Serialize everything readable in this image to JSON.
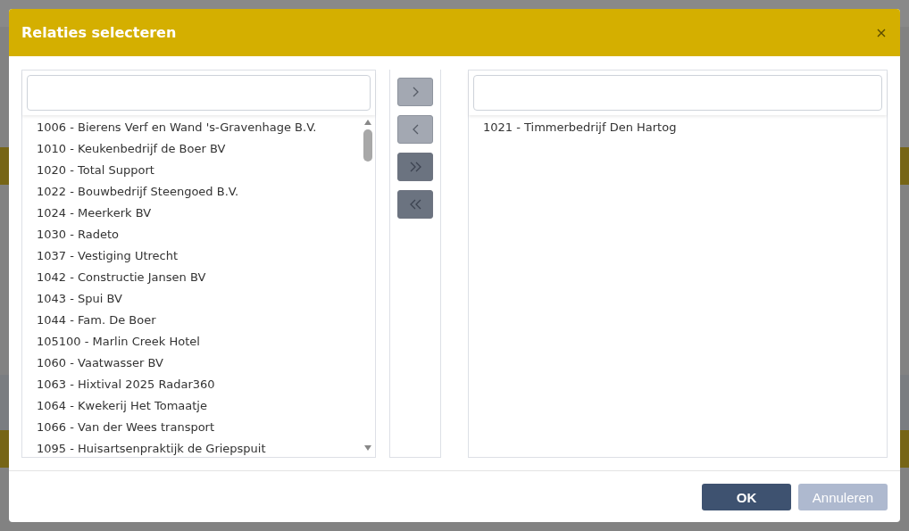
{
  "dialog": {
    "title": "Relaties selecteren"
  },
  "available": {
    "items": [
      {
        "label": "1006 - Bierens Verf en Wand 's-Gravenhage B.V.",
        "selected": false
      },
      {
        "label": "1010 - Keukenbedrijf de Boer BV",
        "selected": false
      },
      {
        "label": "1020 - Total Support",
        "selected": false
      },
      {
        "label": "1022 - Bouwbedrijf Steengoed B.V.",
        "selected": false
      },
      {
        "label": "1024 - Meerkerk BV",
        "selected": false
      },
      {
        "label": "1030 - Radeto",
        "selected": false
      },
      {
        "label": "1037 - Vestiging Utrecht",
        "selected": false
      },
      {
        "label": "1042 - Constructie Jansen BV",
        "selected": false
      },
      {
        "label": "1043 - Spui BV",
        "selected": false
      },
      {
        "label": "1044 - Fam. De Boer",
        "selected": false
      },
      {
        "label": "105100 - Marlin Creek Hotel",
        "selected": false
      },
      {
        "label": "1060 - Vaatwasser BV",
        "selected": false
      },
      {
        "label": "1063 - Hixtival 2025 Radar360",
        "selected": false
      },
      {
        "label": "1064 - Kwekerij Het Tomaatje",
        "selected": false
      },
      {
        "label": "1066 - Van der Wees transport",
        "selected": false
      },
      {
        "label": "1095 - Huisartsenpraktijk de Griepspuit",
        "selected": false
      }
    ]
  },
  "move_buttons": [
    {
      "kind": "right",
      "disabled": true
    },
    {
      "kind": "left",
      "disabled": true
    },
    {
      "kind": "all-right",
      "disabled": false
    },
    {
      "kind": "all-left",
      "disabled": false
    }
  ],
  "chosen": {
    "items": [
      {
        "label": "1021 - Timmerbedrijf Den Hartog",
        "selected": false
      }
    ]
  },
  "buttons": [
    {
      "label": "OK",
      "kind": "primary"
    },
    {
      "label": "Annuleren",
      "kind": "secondary"
    }
  ]
}
